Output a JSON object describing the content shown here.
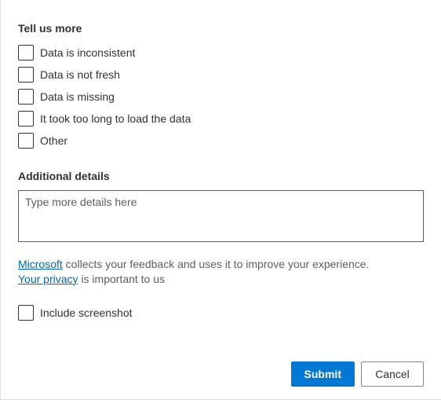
{
  "tell_us_more": {
    "title": "Tell us more",
    "options": [
      "Data is inconsistent",
      "Data is not fresh",
      "Data is missing",
      "It took too long to load the data",
      "Other"
    ]
  },
  "additional_details": {
    "title": "Additional details",
    "placeholder": "Type more details here",
    "value": ""
  },
  "disclaimer": {
    "link1": "Microsoft",
    "text1": " collects your feedback and uses it to improve your experience. ",
    "link2": "Your privacy",
    "text2": " is important to us"
  },
  "include_screenshot_label": "Include screenshot",
  "buttons": {
    "submit": "Submit",
    "cancel": "Cancel"
  }
}
